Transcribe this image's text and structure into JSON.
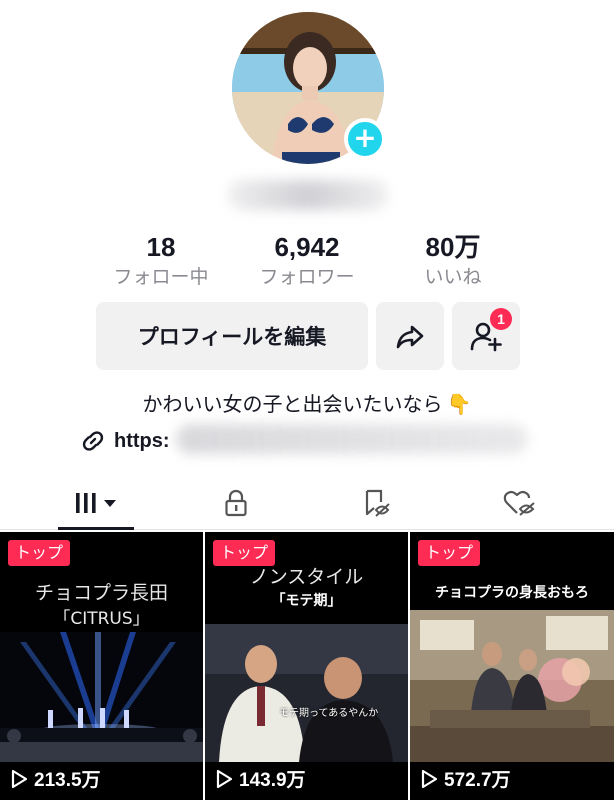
{
  "profile": {
    "avatar_icon": "profile-avatar",
    "add_icon": "plus-icon"
  },
  "stats": [
    {
      "value": "18",
      "label": "フォロー中"
    },
    {
      "value": "6,942",
      "label": "フォロワー"
    },
    {
      "value": "80万",
      "label": "いいね"
    }
  ],
  "buttons": {
    "edit_label": "プロフィールを編集",
    "share_icon": "share-arrow-icon",
    "friend_icon": "add-friend-icon",
    "friend_badge": "1"
  },
  "bio": {
    "text": "かわいい女の子と出会いたいなら",
    "emoji": "👇",
    "link_prefix": "https:"
  },
  "tabs": [
    {
      "name": "videos-tab",
      "icon": "grid-icon"
    },
    {
      "name": "private-tab",
      "icon": "lock-icon"
    },
    {
      "name": "saved-tab",
      "icon": "bookmark-hidden-icon"
    },
    {
      "name": "liked-tab",
      "icon": "heart-hidden-icon"
    }
  ],
  "videos": [
    {
      "badge": "トップ",
      "title": "チョコプラ長田",
      "subtitle": "「CITRUS」",
      "views": "213.5万"
    },
    {
      "badge": "トップ",
      "title": "ノンスタイル",
      "subtitle": "「モテ期」",
      "caption": "モテ期ってあるやんか",
      "views": "143.9万"
    },
    {
      "badge": "トップ",
      "title": "チョコプラの身長おもろ",
      "views": "572.7万"
    }
  ],
  "colors": {
    "accent": "#fe2c55",
    "plus_badge": "#20d5ec",
    "text_primary": "#161823",
    "text_secondary": "#8a8b91",
    "button_bg": "#f1f1f2"
  }
}
